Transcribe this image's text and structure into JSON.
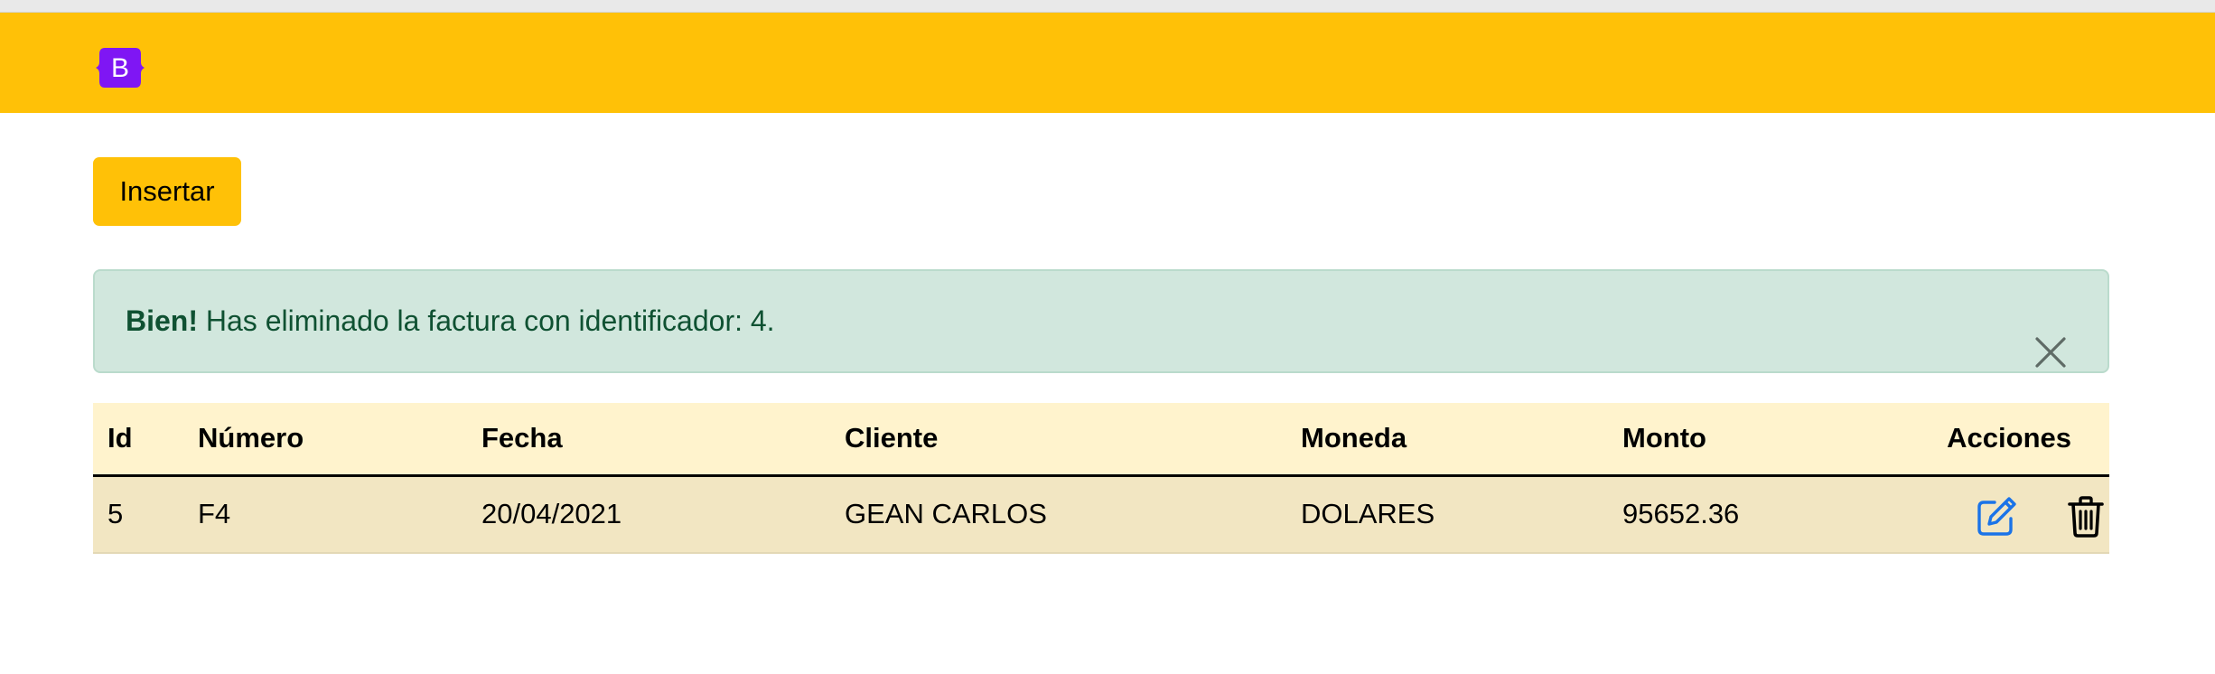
{
  "navbar": {
    "brand_icon": "bootstrap-logo-icon",
    "brand_letter": "B",
    "colors": {
      "background": "#ffc107",
      "brand": "#7952b3"
    }
  },
  "toolbar": {
    "insert_label": "Insertar"
  },
  "alert": {
    "strong": "Bien!",
    "text": " Has eliminado la factura con identificador: 4.",
    "close_icon": "close-icon",
    "colors": {
      "background": "#d1e7dd",
      "text": "#0f5132"
    }
  },
  "table": {
    "headers": [
      "Id",
      "Número",
      "Fecha",
      "Cliente",
      "Moneda",
      "Monto",
      "Acciones"
    ],
    "rows": [
      {
        "id": "5",
        "numero": "F4",
        "fecha": "20/04/2021",
        "cliente": "GEAN CARLOS",
        "moneda": "DOLARES",
        "monto": "95652.36",
        "actions": [
          "edit-icon",
          "trash-icon"
        ]
      }
    ]
  }
}
